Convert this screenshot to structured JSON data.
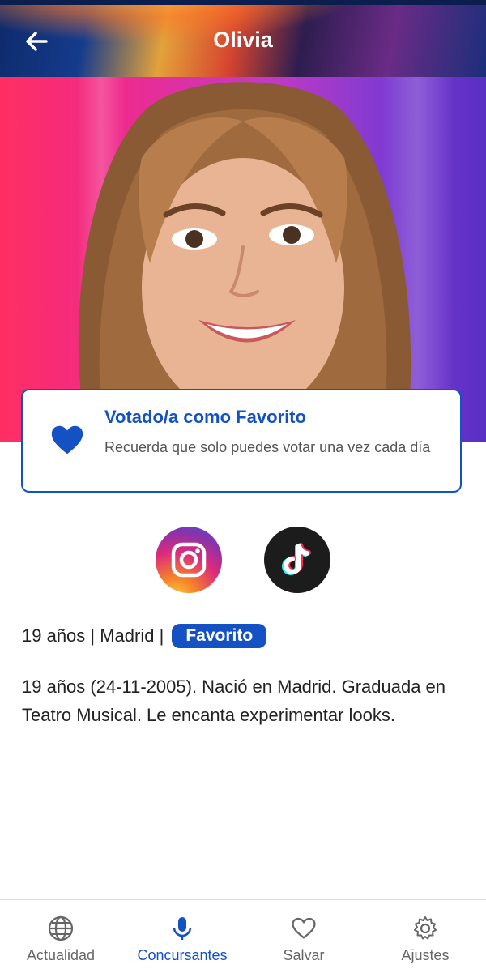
{
  "header": {
    "title": "Olivia",
    "back_icon": "arrow-left-icon"
  },
  "hero": {
    "photo_alt": "Olivia portrait"
  },
  "vote_card": {
    "title": "Votado/a como Favorito",
    "description": "Recuerda que solo puedes votar una vez cada día",
    "icon": "heart-filled-icon"
  },
  "social": [
    {
      "name": "Instagram",
      "icon": "instagram-icon"
    },
    {
      "name": "TikTok",
      "icon": "tiktok-icon"
    }
  ],
  "info": {
    "age_city": "19 años | Madrid |",
    "badge": "Favorito"
  },
  "bio": "19 años (24-11-2005). Nació en Madrid. Graduada en Teatro Musical. Le encanta experimentar looks.",
  "nav": [
    {
      "label": "Actualidad",
      "icon": "globe-icon",
      "active": false
    },
    {
      "label": "Concursantes",
      "icon": "microphone-icon",
      "active": true
    },
    {
      "label": "Salvar",
      "icon": "heart-outline-icon",
      "active": false
    },
    {
      "label": "Ajustes",
      "icon": "gear-icon",
      "active": false
    }
  ],
  "colors": {
    "accent": "#1452c4",
    "text": "#222222",
    "muted": "#666666"
  }
}
